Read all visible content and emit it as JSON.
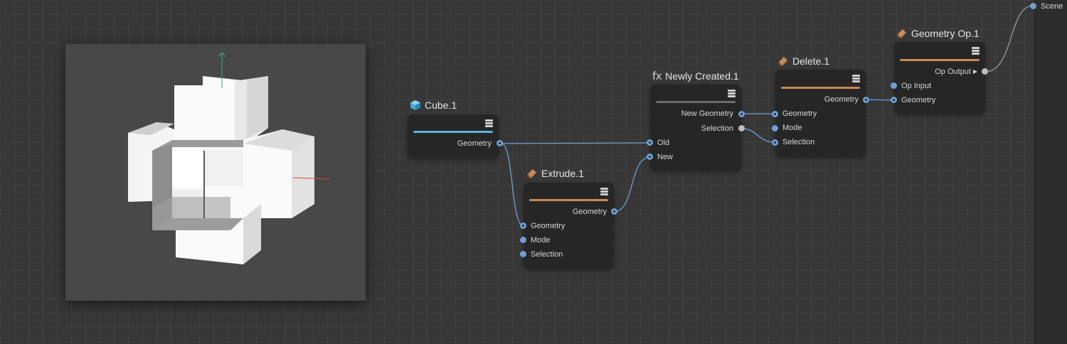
{
  "scene": {
    "label": "Scene"
  },
  "nodes": {
    "cube": {
      "title": "Cube.1",
      "bar_color": "#5fb3d6",
      "outputs": [
        "Geometry"
      ]
    },
    "extrude": {
      "title": "Extrude.1",
      "bar_color": "#c88a56",
      "outputs": [
        "Geometry"
      ],
      "inputs": [
        "Geometry",
        "Mode",
        "Selection"
      ]
    },
    "newly": {
      "title": "Newly Created.1",
      "title_icon": "fx",
      "bar_color": "#6b6b6b",
      "outputs": [
        "New Geometry",
        "Selection"
      ],
      "inputs": [
        "Old",
        "New"
      ]
    },
    "delete": {
      "title": "Delete.1",
      "bar_color": "#c88a56",
      "outputs": [
        "Geometry"
      ],
      "inputs": [
        "Geometry",
        "Mode",
        "Selection"
      ]
    },
    "geomop": {
      "title": "Geometry Op.1",
      "bar_color": "#c88a56",
      "outputs": [
        "Op Output"
      ],
      "inputs": [
        "Op Input",
        "Geometry"
      ]
    }
  },
  "colors": {
    "port": "#6e9fd6",
    "wire": "#6e9fd6",
    "wire_grey": "#9a9a9a"
  },
  "icons": {
    "cube": "cube-icon",
    "op": "geometry-op-icon",
    "menu": "hamburger-menu-icon"
  }
}
